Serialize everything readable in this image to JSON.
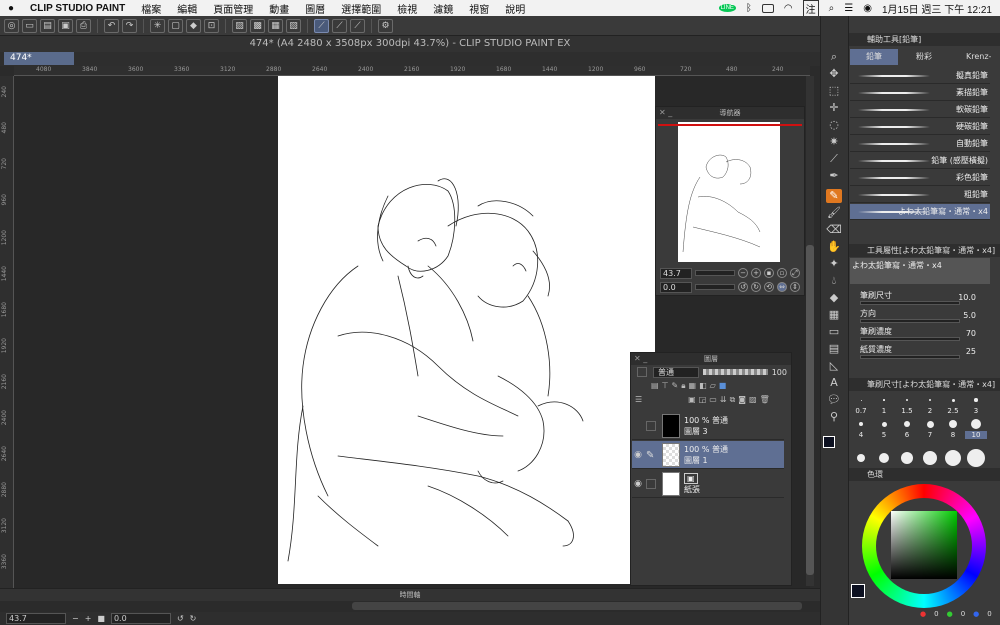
{
  "menubar": {
    "app": "CLIP STUDIO PAINT",
    "items": [
      "檔案",
      "編輯",
      "頁面管理",
      "動畫",
      "圖層",
      "選擇範圍",
      "檢視",
      "濾鏡",
      "視窗",
      "說明"
    ],
    "right": {
      "line": "LINE",
      "ime": "注",
      "date": "1月15日 週三 下午 12:21"
    }
  },
  "window": {
    "title": "474* (A4 2480 x 3508px 300dpi 43.7%) - CLIP STUDIO PAINT EX",
    "tab": "474*"
  },
  "ruler": {
    "h": [
      "4080",
      "3840",
      "3600",
      "3360",
      "3120",
      "2880",
      "2640",
      "2400",
      "2160",
      "1920",
      "1680",
      "1440",
      "1200",
      "960",
      "720",
      "480",
      "240"
    ],
    "v": [
      "240",
      "480",
      "720",
      "960",
      "1200",
      "1440",
      "1680",
      "1920",
      "2160",
      "2400",
      "2640",
      "2880",
      "3120",
      "3360"
    ]
  },
  "navigator": {
    "title": "導航器",
    "zoom": "43.7",
    "angle": "0.0"
  },
  "layers": {
    "title": "圖層",
    "blend": "普通",
    "opacity": "100",
    "items": [
      {
        "opacity": "100 %",
        "blend": "普通",
        "name": "圖層 3",
        "selected": false,
        "visible": false
      },
      {
        "opacity": "100 %",
        "blend": "普通",
        "name": "圖層 1",
        "selected": true,
        "visible": true
      },
      {
        "name": "紙張",
        "selected": false,
        "visible": true
      }
    ]
  },
  "timeline": {
    "title": "時間軸"
  },
  "status": {
    "zoom": "43.7",
    "angle": "0.0"
  },
  "subtool": {
    "title": "輔助工具[鉛筆]",
    "tabs": [
      "鉛筆",
      "粉彩",
      "Krenz-"
    ],
    "brushes": [
      "擬真鉛筆",
      "素描鉛筆",
      "軟碳鉛筆",
      "硬碳鉛筆",
      "自動鉛筆",
      "鉛筆 (感壓橫擬)",
      "彩色鉛筆",
      "粗鉛筆",
      "よわ太鉛筆寫・通常・x4"
    ]
  },
  "toolprop": {
    "title": "工具屬性[よわ太鉛筆寫・通常・x4]",
    "brush": "よわ太鉛筆寫・通常・x4",
    "props": [
      {
        "label": "筆刷尺寸",
        "value": "10.0"
      },
      {
        "label": "方向",
        "value": "5.0"
      },
      {
        "label": "筆刷濃度",
        "value": "70"
      },
      {
        "label": "紙質濃度",
        "value": "25"
      }
    ]
  },
  "brushsize": {
    "title": "筆刷尺寸[よわ太鉛筆寫・通常・x4]",
    "sizes": [
      "0.7",
      "1",
      "1.5",
      "2",
      "2.5",
      "3",
      "4",
      "5",
      "6",
      "7",
      "8",
      "10"
    ]
  },
  "color": {
    "title": "色環",
    "fg": "#0c1020",
    "r": "0",
    "g": "0",
    "b": "0"
  }
}
